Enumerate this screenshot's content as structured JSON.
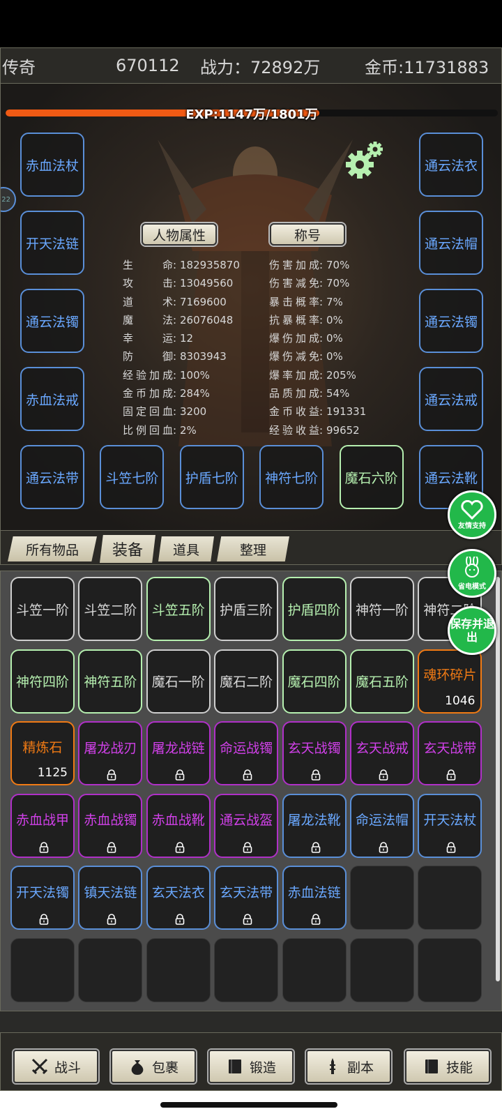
{
  "topbar": {
    "title": "传奇",
    "id": "670112",
    "power": "战力：72892万",
    "gold": "金币:11731883"
  },
  "exp": {
    "text": "EXP:1147万/1801万",
    "progress": 0.6368
  },
  "side_token": "22",
  "equip_left": [
    "赤血法杖",
    "开天法链",
    "通云法镯",
    "赤血法戒"
  ],
  "equip_right": [
    "通云法衣",
    "通云法帽",
    "通云法镯",
    "通云法戒"
  ],
  "equip_bottom": [
    {
      "label": "通云法带",
      "tier": "blue"
    },
    {
      "label": "斗笠七阶",
      "tier": "blue"
    },
    {
      "label": "护盾七阶",
      "tier": "blue"
    },
    {
      "label": "神符七阶",
      "tier": "blue"
    },
    {
      "label": "魔石六阶",
      "tier": "green"
    },
    {
      "label": "通云法靴",
      "tier": "blue"
    }
  ],
  "panel_buttons": {
    "attributes": "人物属性",
    "titles": "称号"
  },
  "stats_left": [
    {
      "k": "生命",
      "v": "182935870"
    },
    {
      "k": "攻击",
      "v": "13049560"
    },
    {
      "k": "道术",
      "v": "7169600"
    },
    {
      "k": "魔法",
      "v": "26076048"
    },
    {
      "k": "幸运",
      "v": "12"
    },
    {
      "k": "防御",
      "v": "8303943"
    },
    {
      "k": "经验加成",
      "v": "100%"
    },
    {
      "k": "金币加成",
      "v": "284%"
    },
    {
      "k": "固定回血",
      "v": "3200"
    },
    {
      "k": "比例回血",
      "v": "2%"
    }
  ],
  "stats_right": [
    {
      "k": "伤害加成",
      "v": "70%"
    },
    {
      "k": "伤害减免",
      "v": "70%"
    },
    {
      "k": "暴击概率",
      "v": "7%"
    },
    {
      "k": "抗暴概率",
      "v": "0%"
    },
    {
      "k": "爆伤加成",
      "v": "0%"
    },
    {
      "k": "爆伤减免",
      "v": "0%"
    },
    {
      "k": "爆率加成",
      "v": "205%"
    },
    {
      "k": "品质加成",
      "v": "54%"
    },
    {
      "k": "金币收益",
      "v": "191331"
    },
    {
      "k": "经验收益",
      "v": "99652"
    }
  ],
  "tabs": [
    "所有物品",
    "装备",
    "道具",
    "整理"
  ],
  "inventory": [
    {
      "label": "斗笠一阶",
      "tier": "white"
    },
    {
      "label": "斗笠二阶",
      "tier": "white"
    },
    {
      "label": "斗笠五阶",
      "tier": "green"
    },
    {
      "label": "护盾三阶",
      "tier": "white"
    },
    {
      "label": "护盾四阶",
      "tier": "green"
    },
    {
      "label": "神符一阶",
      "tier": "white"
    },
    {
      "label": "神符二阶",
      "tier": "white"
    },
    {
      "label": "神符四阶",
      "tier": "green"
    },
    {
      "label": "神符五阶",
      "tier": "green"
    },
    {
      "label": "魔石一阶",
      "tier": "white"
    },
    {
      "label": "魔石二阶",
      "tier": "white"
    },
    {
      "label": "魔石四阶",
      "tier": "green"
    },
    {
      "label": "魔石五阶",
      "tier": "green"
    },
    {
      "label": "魂环碎片",
      "tier": "orange",
      "count": "1046"
    },
    {
      "label": "精炼石",
      "tier": "orange",
      "count": "1125"
    },
    {
      "label": "屠龙战刃",
      "tier": "purple",
      "locked": true
    },
    {
      "label": "屠龙战链",
      "tier": "purple",
      "locked": true
    },
    {
      "label": "命运战镯",
      "tier": "purple",
      "locked": true
    },
    {
      "label": "玄天战镯",
      "tier": "purple",
      "locked": true
    },
    {
      "label": "玄天战戒",
      "tier": "purple",
      "locked": true
    },
    {
      "label": "玄天战带",
      "tier": "purple",
      "locked": true
    },
    {
      "label": "赤血战甲",
      "tier": "purple",
      "locked": true
    },
    {
      "label": "赤血战镯",
      "tier": "purple",
      "locked": true
    },
    {
      "label": "赤血战靴",
      "tier": "purple",
      "locked": true
    },
    {
      "label": "通云战盔",
      "tier": "purple",
      "locked": true
    },
    {
      "label": "屠龙法靴",
      "tier": "blue",
      "locked": true
    },
    {
      "label": "命运法帽",
      "tier": "blue",
      "locked": true
    },
    {
      "label": "开天法杖",
      "tier": "blue",
      "locked": true
    },
    {
      "label": "开天法镯",
      "tier": "blue",
      "locked": true
    },
    {
      "label": "镇天法链",
      "tier": "blue",
      "locked": true
    },
    {
      "label": "玄天法衣",
      "tier": "blue",
      "locked": true
    },
    {
      "label": "玄天法带",
      "tier": "blue",
      "locked": true
    },
    {
      "label": "赤血法链",
      "tier": "blue",
      "locked": true
    }
  ],
  "inventory_slots": 42,
  "float_buttons": {
    "support": "友情支持",
    "power_save": "省电模式",
    "save_exit": "保存并退出"
  },
  "nav": [
    {
      "label": "战斗",
      "icon": "crossed-swords-icon"
    },
    {
      "label": "包裹",
      "icon": "money-bag-icon"
    },
    {
      "label": "锻造",
      "icon": "book-icon"
    },
    {
      "label": "副本",
      "icon": "tower-icon"
    },
    {
      "label": "技能",
      "icon": "book-icon"
    }
  ],
  "colors": {
    "blue": "#6aa8ff",
    "green": "#b6f0b0",
    "orange": "#f07a14",
    "purple": "#d040e8",
    "exp": "#f05a14",
    "float": "#22b84a"
  }
}
